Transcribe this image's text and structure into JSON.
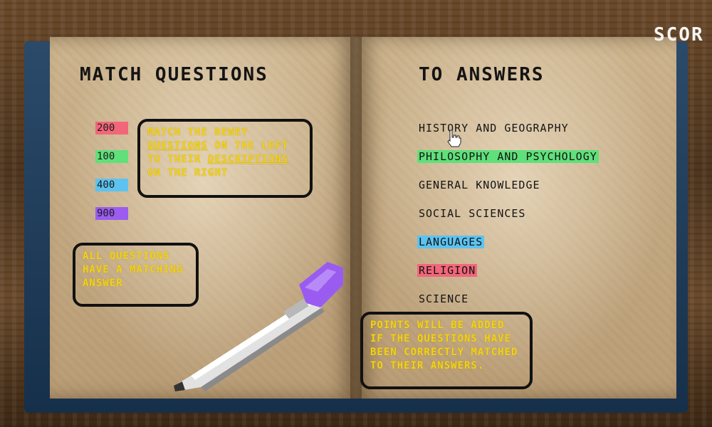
{
  "score_label": "SCOR",
  "headings": {
    "left": "MATCH QUESTIONS",
    "right": "TO ANSWERS"
  },
  "questions": [
    {
      "label": "200",
      "color": "#f2667a"
    },
    {
      "label": "100",
      "color": "#5fe07a"
    },
    {
      "label": "400",
      "color": "#5cc3f0"
    },
    {
      "label": "900",
      "color": "#9b5cf0"
    }
  ],
  "answers": [
    {
      "label": "HISTORY AND GEOGRAPHY",
      "highlight": null
    },
    {
      "label": "PHILOSOPHY AND PSYCHOLOGY",
      "highlight": "#5fe07a"
    },
    {
      "label": "GENERAL KNOWLEDGE",
      "highlight": null
    },
    {
      "label": "SOCIAL SCIENCES",
      "highlight": null
    },
    {
      "label": "LANGUAGES",
      "highlight": "#5cc3f0"
    },
    {
      "label": "RELIGION",
      "highlight": "#f2667a"
    },
    {
      "label": "SCIENCE",
      "highlight": null
    }
  ],
  "notes": {
    "instructions": {
      "part1": "MATCH THE DEWEY",
      "part2": "QUESTIONS",
      "part3": " ON THE LEFT TO THEIR ",
      "part4": "DESCRIPTIONS",
      "part5": " ON THE RIGHT"
    },
    "all_questions": "ALL QUESTIONS HAVE A MATCHING ANSWER",
    "points": "POINTS WILL BE ADDED IF THE QUESTIONS HAVE BEEN CORRECTLY MATCHED TO THEIR ANSWERS."
  },
  "icons": {
    "pen": "purple-pen-icon",
    "cursor": "hand-pointer-icon"
  },
  "colors": {
    "note_text": "#f2d21a",
    "book_cover": "#1f3c5c",
    "page": "#c8ae88"
  }
}
